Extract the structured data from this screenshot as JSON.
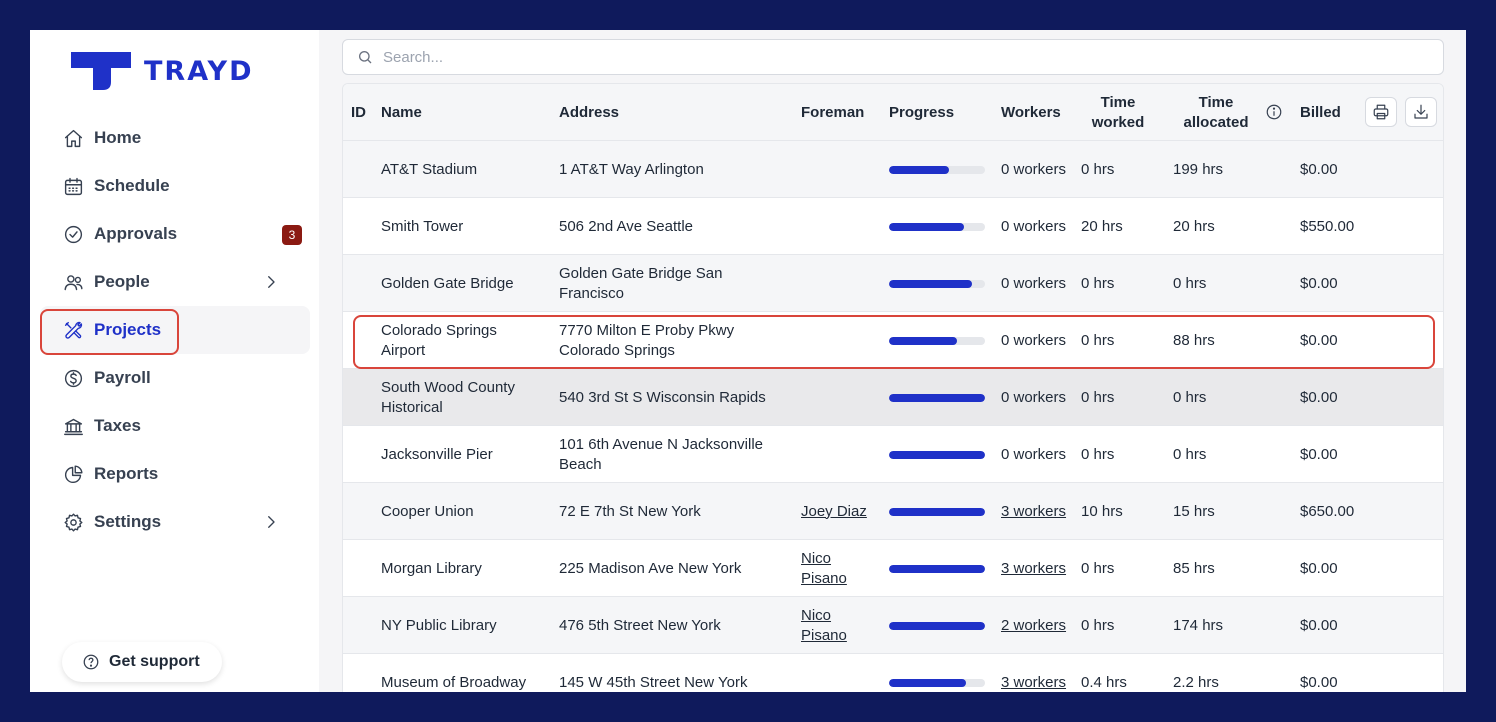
{
  "brand": {
    "name": "TRAYD",
    "color": "#1f31c8"
  },
  "sidebar": {
    "items": [
      {
        "label": "Home",
        "icon": "home-icon"
      },
      {
        "label": "Schedule",
        "icon": "calendar-icon"
      },
      {
        "label": "Approvals",
        "icon": "check-circle-icon",
        "badge": "3"
      },
      {
        "label": "People",
        "icon": "people-icon"
      },
      {
        "label": "Projects",
        "icon": "tools-icon"
      },
      {
        "label": "Payroll",
        "icon": "dollar-icon"
      },
      {
        "label": "Taxes",
        "icon": "bank-icon"
      },
      {
        "label": "Reports",
        "icon": "pie-chart-icon"
      },
      {
        "label": "Settings",
        "icon": "gear-icon"
      }
    ],
    "support_label": "Get support"
  },
  "search": {
    "placeholder": "Search..."
  },
  "table": {
    "headers": {
      "id": "ID",
      "name": "Name",
      "address": "Address",
      "foreman": "Foreman",
      "progress": "Progress",
      "workers": "Workers",
      "time_worked": "Time worked",
      "time_allocated": "Time allocated",
      "billed": "Billed"
    },
    "rows": [
      {
        "name": "AT&T Stadium",
        "address": "1 AT&T Way Arlington",
        "foreman": "",
        "progress": 0.62,
        "workers": "0 workers",
        "time_worked": "0 hrs",
        "time_allocated": "199 hrs",
        "billed": "$0.00"
      },
      {
        "name": "Smith Tower",
        "address": "506 2nd Ave Seattle",
        "foreman": "",
        "progress": 0.78,
        "workers": "0 workers",
        "time_worked": "20 hrs",
        "time_allocated": "20 hrs",
        "billed": "$550.00"
      },
      {
        "name": "Golden Gate Bridge",
        "address": "Golden Gate Bridge San Francisco",
        "foreman": "",
        "progress": 0.86,
        "workers": "0 workers",
        "time_worked": "0 hrs",
        "time_allocated": "0 hrs",
        "billed": "$0.00"
      },
      {
        "name": "Colorado Springs Airport",
        "address": "7770 Milton E Proby Pkwy Colorado Springs",
        "foreman": "",
        "progress": 0.71,
        "workers": "0 workers",
        "time_worked": "0 hrs",
        "time_allocated": "88 hrs",
        "billed": "$0.00"
      },
      {
        "name": "South Wood County Historical",
        "address": "540 3rd St S Wisconsin Rapids",
        "foreman": "",
        "progress": 1.0,
        "workers": "0 workers",
        "time_worked": "0 hrs",
        "time_allocated": "0 hrs",
        "billed": "$0.00"
      },
      {
        "name": "Jacksonville Pier",
        "address": "101 6th Avenue N Jacksonville Beach",
        "foreman": "",
        "progress": 1.0,
        "workers": "0 workers",
        "time_worked": "0 hrs",
        "time_allocated": "0 hrs",
        "billed": "$0.00"
      },
      {
        "name": "Cooper Union",
        "address": "72 E 7th St New York",
        "foreman": "Joey Diaz",
        "progress": 1.0,
        "workers": "3 workers",
        "time_worked": "10 hrs",
        "time_allocated": "15 hrs",
        "billed": "$650.00"
      },
      {
        "name": "Morgan Library",
        "address": "225 Madison Ave New York",
        "foreman": "Nico Pisano",
        "progress": 1.0,
        "workers": "3 workers",
        "time_worked": "0 hrs",
        "time_allocated": "85 hrs",
        "billed": "$0.00"
      },
      {
        "name": "NY Public Library",
        "address": "476 5th Street New York",
        "foreman": "Nico Pisano",
        "progress": 1.0,
        "workers": "2 workers",
        "time_worked": "0 hrs",
        "time_allocated": "174 hrs",
        "billed": "$0.00"
      },
      {
        "name": "Museum of Broadway",
        "address": "145 W 45th Street New York",
        "foreman": "",
        "progress": 0.8,
        "workers": "3 workers",
        "time_worked": "0.4 hrs",
        "time_allocated": "2.2 hrs",
        "billed": "$0.00"
      }
    ]
  }
}
